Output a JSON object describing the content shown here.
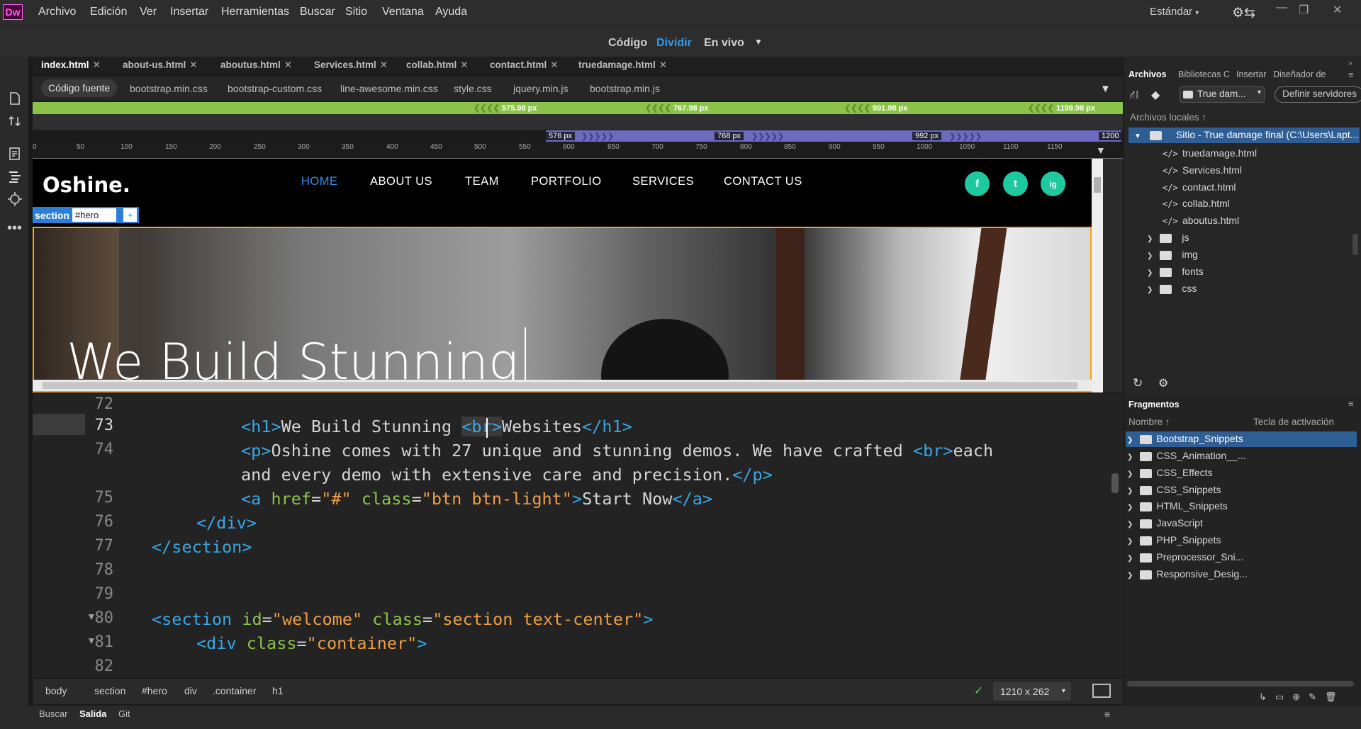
{
  "app": {
    "logo": "Dw"
  },
  "menu": [
    "Archivo",
    "Edición",
    "Ver",
    "Insertar",
    "Herramientas",
    "Buscar",
    "Sitio",
    "Ventana",
    "Ayuda"
  ],
  "workspace": {
    "label": "Estándar"
  },
  "views": {
    "code": "Código",
    "split": "Dividir",
    "live": "En vivo"
  },
  "tabs": [
    "index.html",
    "about-us.html",
    "aboutus.html",
    "Services.html",
    "collab.html",
    "contact.html",
    "truedamage.html"
  ],
  "related_files": {
    "source": "Código fuente",
    "files": [
      "bootstrap.min.css",
      "bootstrap-custom.css",
      "line-awesome.min.css",
      "style.css",
      "jquery.min.js",
      "bootstrap.min.js"
    ]
  },
  "media_queries": {
    "green": [
      "575.98",
      "767.98",
      "991.98",
      "1199.98"
    ],
    "purple": [
      "576",
      "768",
      "992",
      "1200"
    ],
    "unit": "px"
  },
  "ruler": [
    "0",
    "50",
    "100",
    "150",
    "200",
    "250",
    "300",
    "350",
    "400",
    "450",
    "500",
    "550",
    "600",
    "650",
    "700",
    "750",
    "800",
    "850",
    "900",
    "950",
    "1000",
    "1050",
    "1100",
    "1150"
  ],
  "live": {
    "logo": "Oshine.",
    "nav": [
      "HOME",
      "ABOUT US",
      "TEAM",
      "PORTFOLIO",
      "SERVICES",
      "CONTACT US"
    ],
    "social": [
      "f",
      "t",
      "ig"
    ],
    "tag": {
      "name": "section",
      "id": "#hero",
      "add": "+"
    },
    "hero_title": "We Build Stunning"
  },
  "code": {
    "line_numbers": [
      "72",
      "73",
      "74",
      "",
      "75",
      "76",
      "77",
      "78",
      "79",
      "80",
      "81",
      "82"
    ],
    "current_line": "73"
  },
  "status": {
    "crumbs": [
      "body",
      "section",
      "#hero",
      "div",
      ".container",
      "h1"
    ],
    "size": "1210 x 262"
  },
  "bottom_tabs": [
    "Buscar",
    "Salida",
    "Git"
  ],
  "panel": {
    "tabs": [
      "Archivos",
      "Bibliotecas C",
      "Insertar",
      "Diseñador de"
    ],
    "site_select": "True dam...",
    "define_servers": "Definir servidores",
    "local_files": "Archivos locales",
    "site_root": "Sitio - True damage final (C:\\Users\\Lapt...",
    "files": [
      "truedamage.html",
      "Services.html",
      "contact.html",
      "collab.html",
      "aboutus.html"
    ],
    "folders": [
      "js",
      "img",
      "fonts",
      "css"
    ]
  },
  "snippets": {
    "title": "Fragmentos",
    "col_name": "Nombre",
    "col_key": "Tecla de activación",
    "items": [
      "Bootstrap_Snippets",
      "CSS_Animation__...",
      "CSS_Effects",
      "CSS_Snippets",
      "HTML_Snippets",
      "JavaScript",
      "PHP_Snippets",
      "Preprocessor_Sni...",
      "Responsive_Desig..."
    ]
  }
}
